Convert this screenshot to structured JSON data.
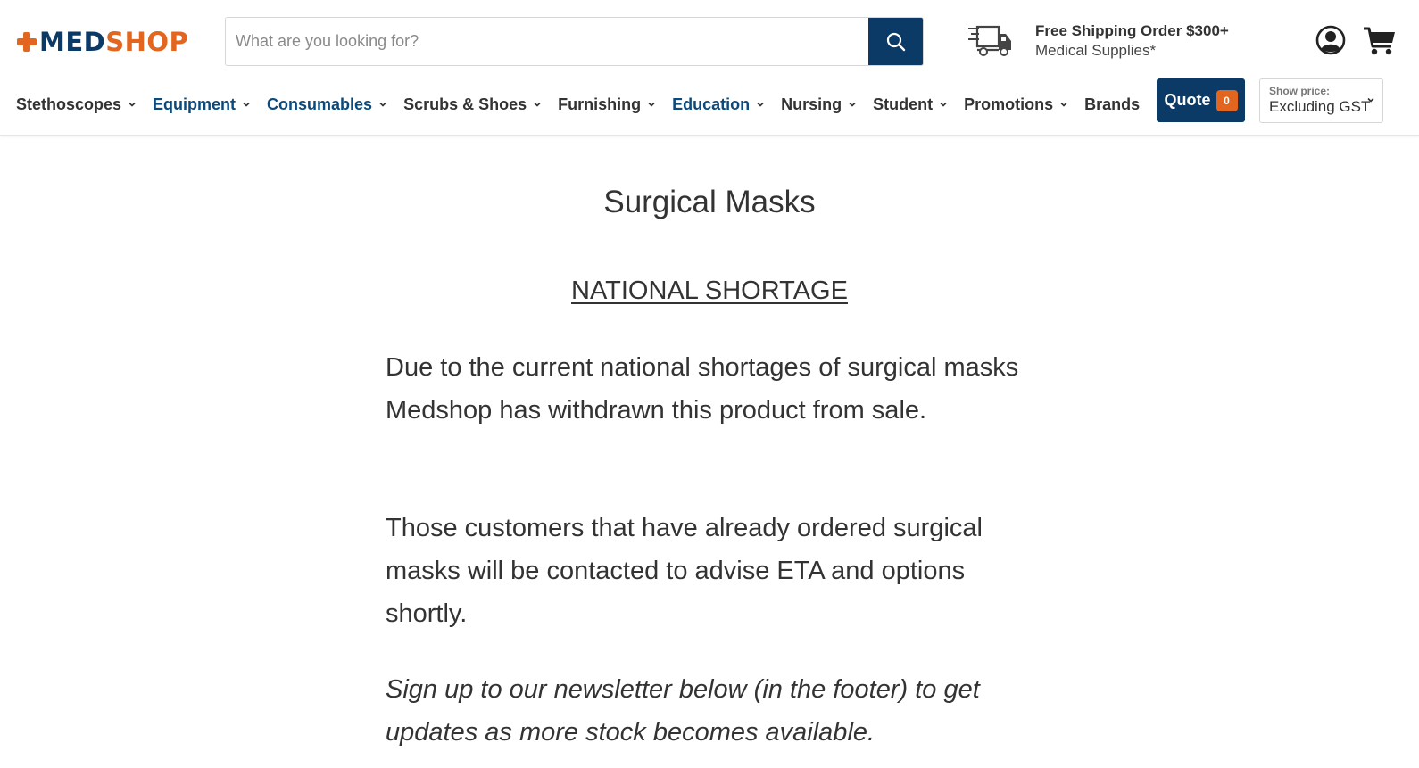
{
  "brand": {
    "logo_part1": "MEDSHOP",
    "logo_med": "MED",
    "logo_shop": "SHOP",
    "primary_color": "#0b3a66",
    "accent_color": "#e2661f",
    "icon": "medical-cross-icon"
  },
  "search": {
    "placeholder": "What are you looking for?",
    "value": "",
    "button_icon": "search-icon"
  },
  "shipping": {
    "icon": "delivery-truck-icon",
    "line1": "Free Shipping Order $300+",
    "line2": "Medical Supplies*"
  },
  "header_icons": {
    "account": "user-account-icon",
    "cart": "shopping-cart-icon"
  },
  "nav": {
    "items": [
      {
        "label": "Stethoscopes",
        "has_dropdown": true
      },
      {
        "label": "Equipment",
        "has_dropdown": true
      },
      {
        "label": "Consumables",
        "has_dropdown": true
      },
      {
        "label": "Scrubs & Shoes",
        "has_dropdown": true
      },
      {
        "label": "Furnishing",
        "has_dropdown": true
      },
      {
        "label": "Education",
        "has_dropdown": true
      },
      {
        "label": "Nursing",
        "has_dropdown": true
      },
      {
        "label": "Student",
        "has_dropdown": true
      },
      {
        "label": "Promotions",
        "has_dropdown": true
      },
      {
        "label": "Brands",
        "has_dropdown": false
      }
    ]
  },
  "quote": {
    "label": "Quote",
    "count": "0"
  },
  "price_toggle": {
    "label": "Show price:",
    "selected": "Excluding GST"
  },
  "page": {
    "title": "Surgical Masks",
    "notice": "NATIONAL SHORTAGE",
    "paragraphs": [
      "Due to the current national shortages of surgical masks Medshop has withdrawn this product from sale.",
      "Those customers that have already ordered surgical masks will be contacted to advise ETA and options shortly.",
      "Sign up to our newsletter below (in the footer) to get updates as more stock becomes available."
    ]
  }
}
